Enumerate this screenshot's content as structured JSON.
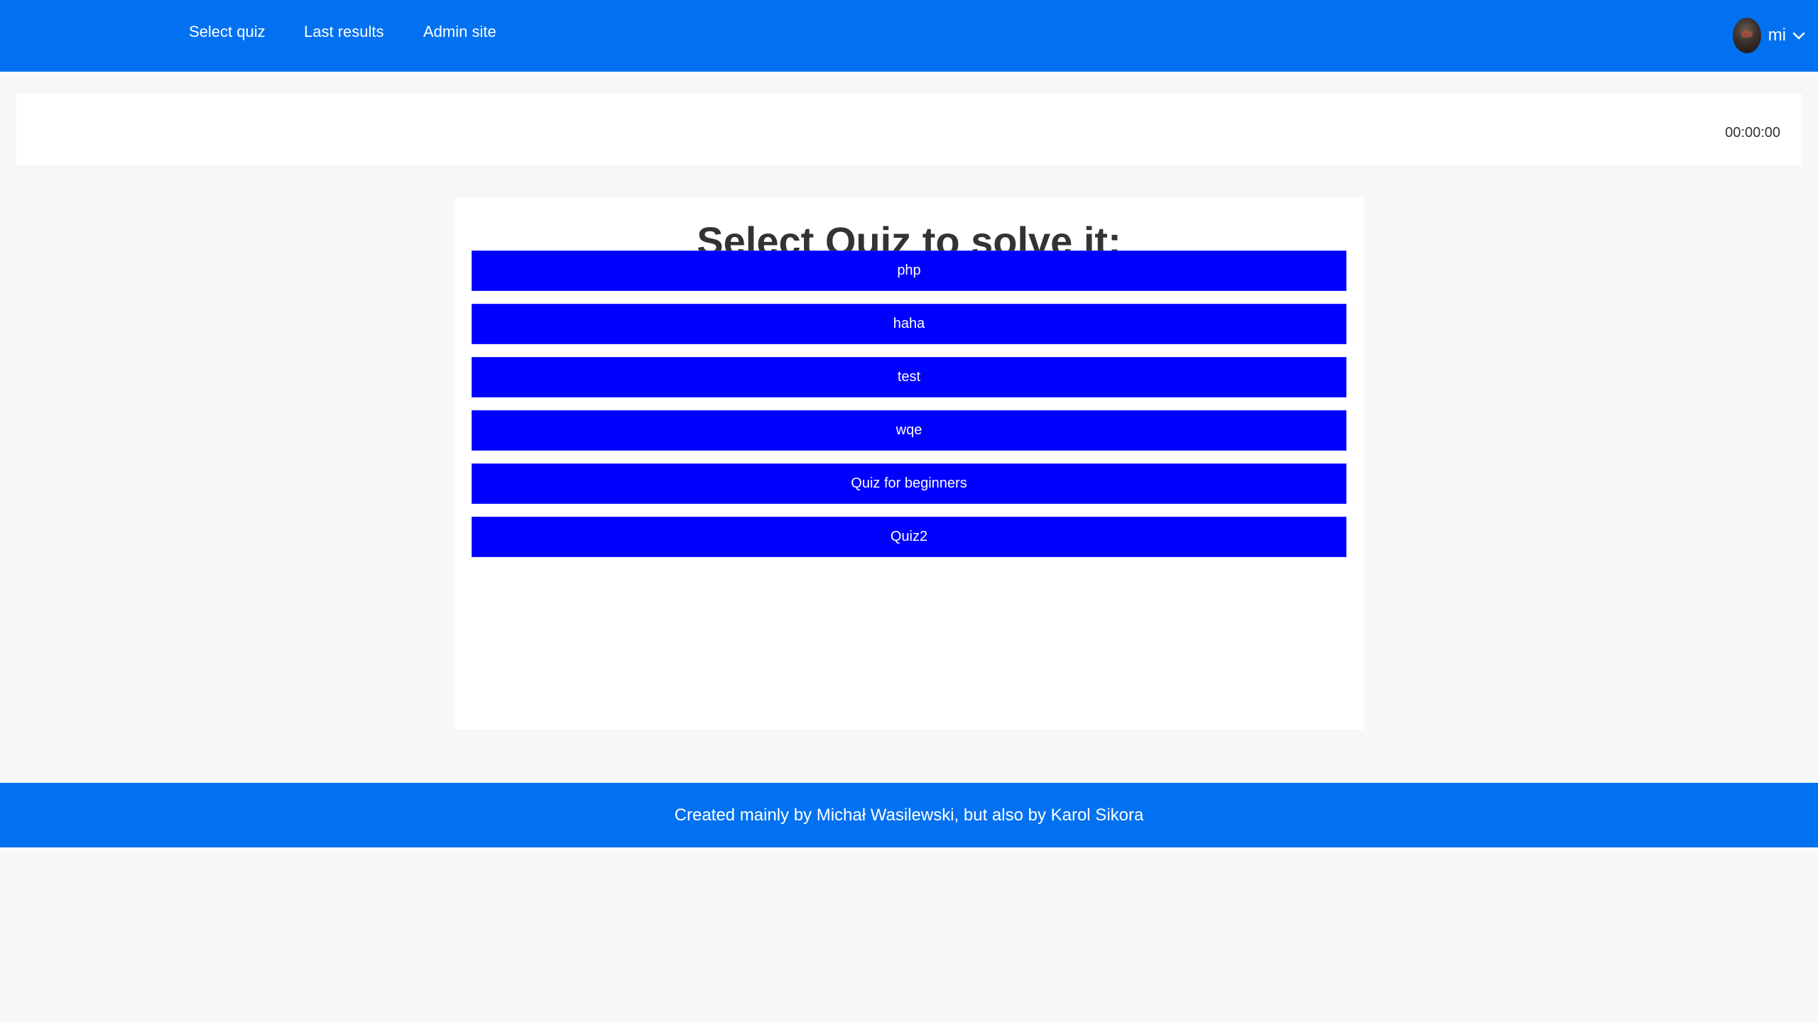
{
  "navbar": {
    "links": [
      {
        "label": "Select quiz"
      },
      {
        "label": "Last results"
      },
      {
        "label": "Admin site"
      }
    ],
    "user": {
      "name": "mi"
    }
  },
  "timer": {
    "value": "00:00:00"
  },
  "quiz_selection": {
    "title": "Select Quiz to solve it:",
    "quizzes": [
      {
        "label": "php"
      },
      {
        "label": "haha"
      },
      {
        "label": "test"
      },
      {
        "label": "wqe"
      },
      {
        "label": "Quiz for beginners"
      },
      {
        "label": "Quiz2"
      }
    ]
  },
  "footer": {
    "text": "Created mainly by Michał Wasilewski, but also by Karol Sikora"
  },
  "colors": {
    "navbar": "#0271f1",
    "quiz_button": "#0000fe",
    "page_background": "#f6f7f9"
  },
  "icons": {
    "user_menu_chevron": "chevron-down-icon",
    "avatar": "avatar"
  }
}
